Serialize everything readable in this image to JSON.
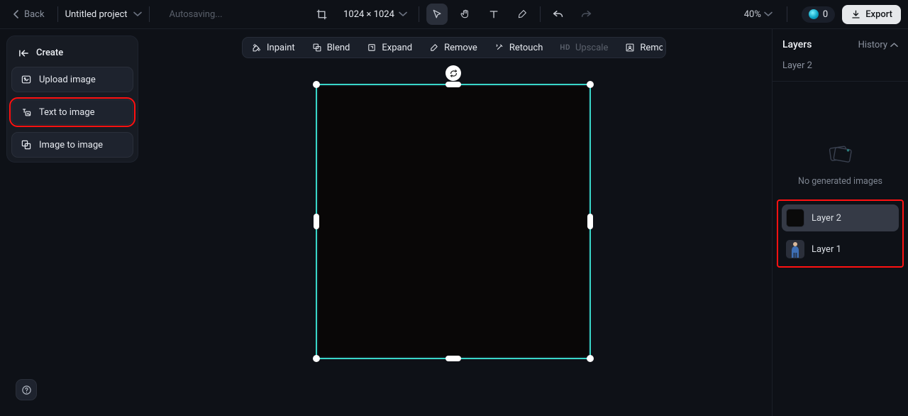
{
  "topbar": {
    "back": "Back",
    "project_title": "Untitled project",
    "autosave": "Autosaving...",
    "canvas_size": "1024 × 1024",
    "zoom": "40%",
    "credits": "0",
    "export": "Export"
  },
  "actions": {
    "inpaint": "Inpaint",
    "blend": "Blend",
    "expand": "Expand",
    "remove": "Remove",
    "retouch": "Retouch",
    "upscale": "Upscale",
    "upscale_badge": "HD",
    "remove_bg": "Remove back…"
  },
  "left": {
    "create": "Create",
    "upload": "Upload image",
    "t2i": "Text to image",
    "i2i": "Image to image"
  },
  "right": {
    "title": "Layers",
    "history": "History",
    "selected_layer": "Layer 2",
    "empty_msg": "No generated images",
    "layers": {
      "0": {
        "label": "Layer 2"
      },
      "1": {
        "label": "Layer 1"
      }
    }
  }
}
